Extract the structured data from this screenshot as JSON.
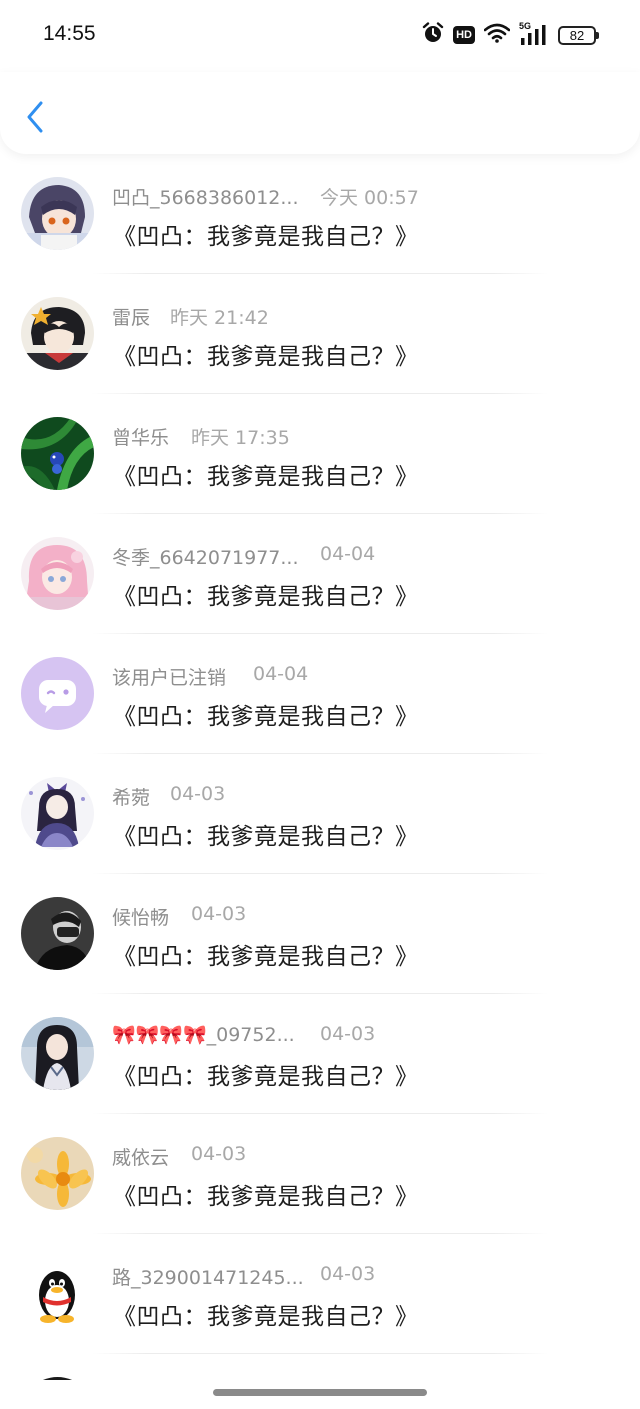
{
  "status_bar": {
    "time": "14:55",
    "hd_label": "HD",
    "network_label": "5G",
    "battery_level": "82"
  },
  "header": {
    "back_icon": "chevron-left-icon",
    "accent": "#2f8ff0"
  },
  "comments": [
    {
      "name": "凹凸_5668386012...",
      "time": "今天 00:57",
      "message": "《凹凸：我爹竟是我自己？》",
      "avatar": "anime-character-purple-hair"
    },
    {
      "name": "雷辰",
      "time": "昨天 21:42",
      "message": "《凹凸：我爹竟是我自己？》",
      "avatar": "anime-character-dark-hair-star"
    },
    {
      "name": "曾华乐",
      "time": "昨天 17:35",
      "message": "《凹凸：我爹竟是我自己？》",
      "avatar": "green-leaves-bird"
    },
    {
      "name": "冬季_6642071977...",
      "time": "04-04",
      "message": "《凹凸：我爹竟是我自己？》",
      "avatar": "anime-girl-pink-hair"
    },
    {
      "name": "该用户已注销",
      "time": "04-04",
      "message": "《凹凸：我爹竟是我自己？》",
      "avatar": "deactivated-user-chat-bubble"
    },
    {
      "name": "希菀",
      "time": "04-03",
      "message": "《凹凸：我爹竟是我自己？》",
      "avatar": "anime-girl-lolita-dress"
    },
    {
      "name": "候怡畅",
      "time": "04-03",
      "message": "《凹凸：我爹竟是我自己？》",
      "avatar": "monochrome-portrait"
    },
    {
      "name": "🎀🎀🎀🎀_09752...",
      "time": "04-03",
      "message": "《凹凸：我爹竟是我自己？》",
      "avatar": "anime-girl-long-dark-hair"
    },
    {
      "name": "威依云",
      "time": "04-03",
      "message": "《凹凸：我爹竟是我自己？》",
      "avatar": "yellow-flower"
    },
    {
      "name": "路_329001471245...",
      "time": "04-03",
      "message": "《凹凸：我爹竟是我自己？》",
      "avatar": "qq-penguin"
    }
  ]
}
